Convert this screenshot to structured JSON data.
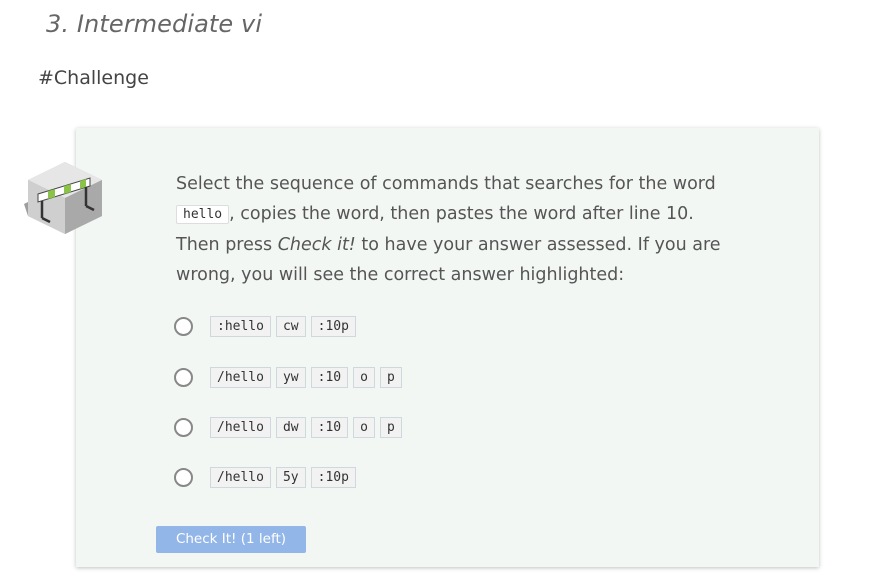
{
  "section": {
    "title": "3. Intermediate vi"
  },
  "challenge": {
    "heading": "#Challenge"
  },
  "question": {
    "icon": "hurdle-icon",
    "text_part1": "Select the sequence of commands that searches for the word ",
    "code_word": "hello",
    "text_part2": ", copies the word, then pastes the word after line 10. Then press ",
    "emphasis": "Check it!",
    "text_part3": " to have your answer assessed. If you are wrong, you will see the correct answer highlighted:"
  },
  "options": [
    {
      "chips": [
        ":hello",
        "cw",
        ":10p"
      ]
    },
    {
      "chips": [
        "/hello",
        "yw",
        ":10",
        "o",
        "p"
      ]
    },
    {
      "chips": [
        "/hello",
        "dw",
        ":10",
        "o",
        "p"
      ]
    },
    {
      "chips": [
        "/hello",
        "5y",
        ":10p"
      ]
    }
  ],
  "check_button": {
    "label": "Check It! (1 left)"
  },
  "colors": {
    "card_background": "#f3f7f4",
    "button_background": "#93b6e8"
  }
}
